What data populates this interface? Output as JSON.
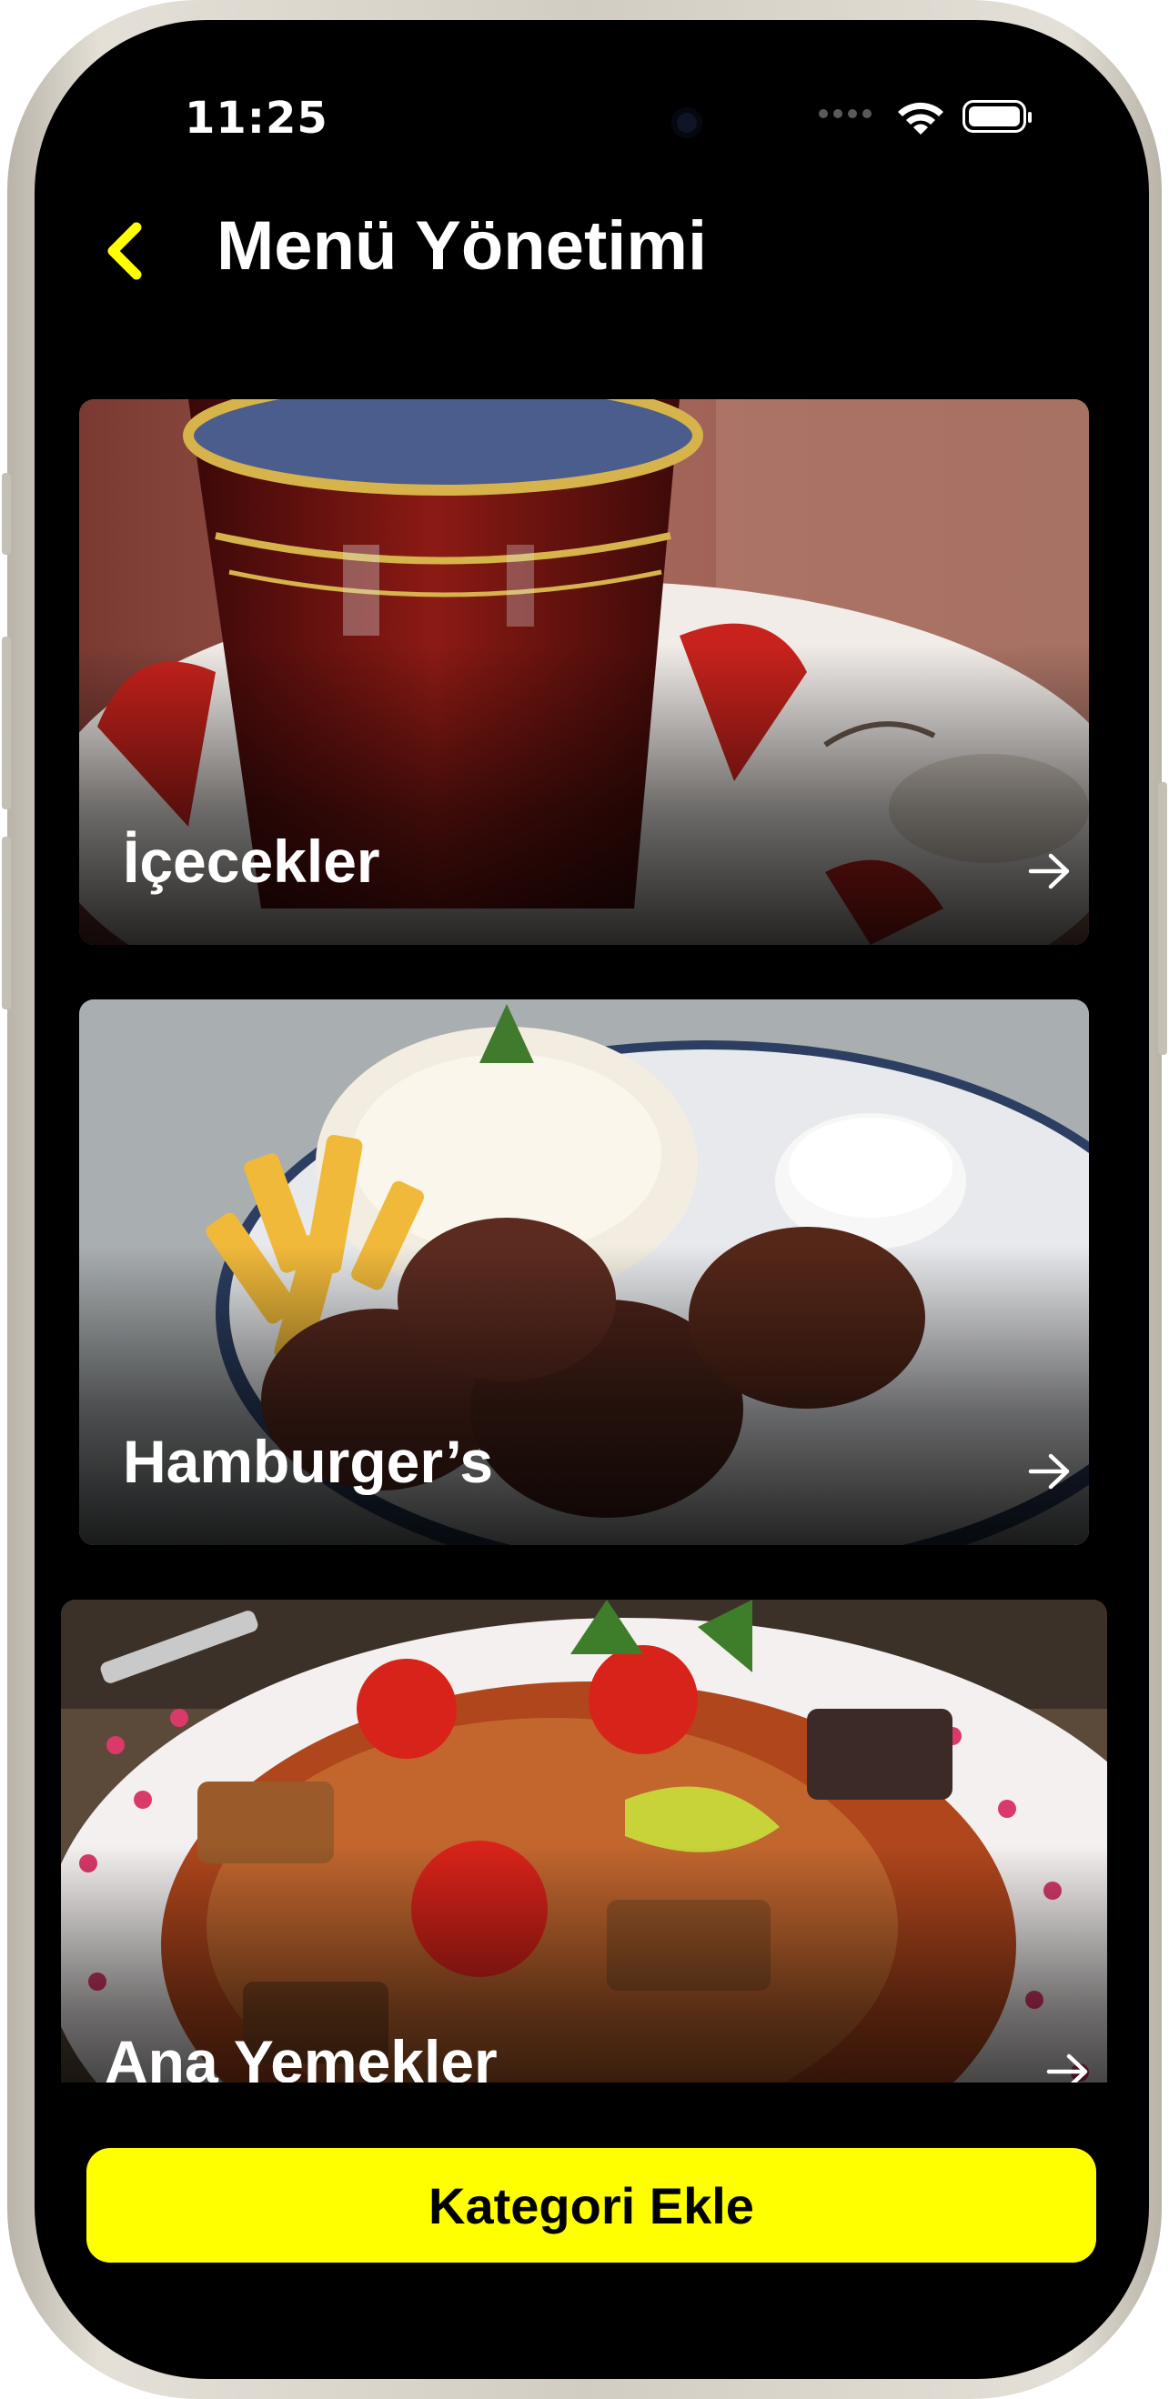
{
  "status_bar": {
    "time": "11:25"
  },
  "header": {
    "title": "Menü Yönetimi",
    "back_icon": "chevron-left-icon"
  },
  "categories": [
    {
      "label": "İçecekler",
      "image": "turkish-tea-glass",
      "arrow_icon": "arrow-right-icon"
    },
    {
      "label": "Hamburger’s",
      "image": "kofte-rice-fries-plate",
      "arrow_icon": "arrow-right-icon"
    },
    {
      "label": "Ana Yemekler",
      "image": "eggplant-stew-plate",
      "arrow_icon": "arrow-right-icon"
    }
  ],
  "footer": {
    "add_category_label": "Kategori Ekle"
  },
  "colors": {
    "accent": "#FFFF00",
    "background": "#000000",
    "text": "#FFFFFF"
  }
}
